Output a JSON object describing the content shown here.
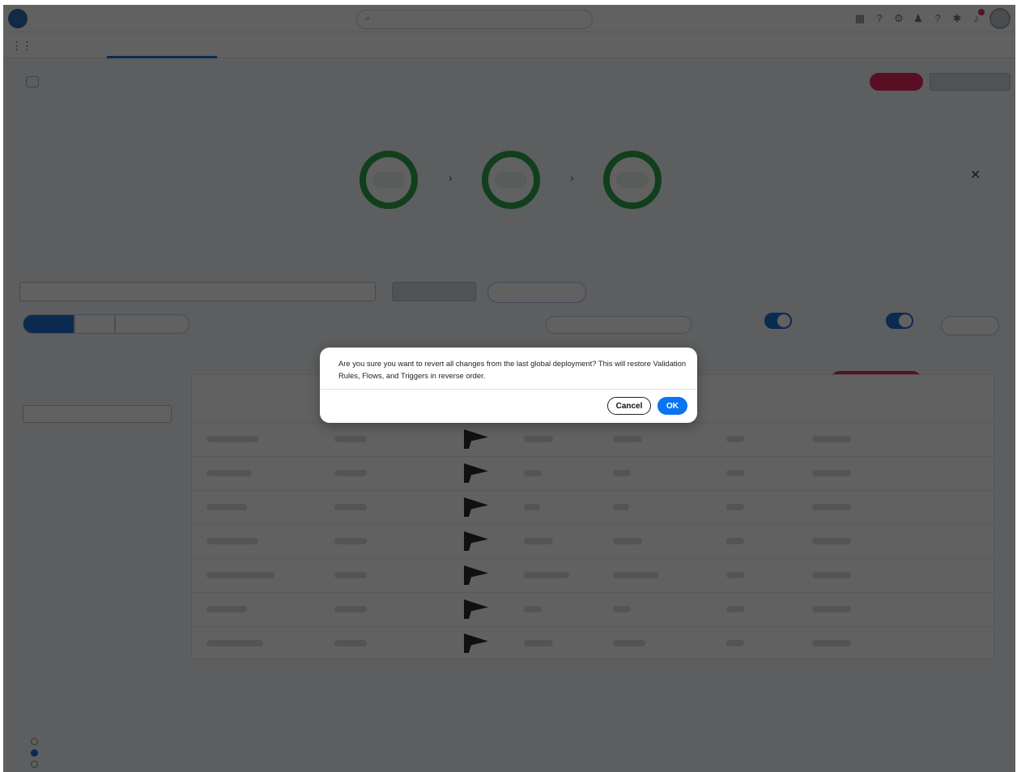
{
  "dialog": {
    "message": "Are you sure you want to revert all changes from the last global deployment? This will restore Validation Rules, Flows, and Triggers in reverse order.",
    "cancel_label": "Cancel",
    "ok_label": "OK"
  },
  "colors": {
    "primary": "#0b74f0",
    "accent_pink": "#e8285d",
    "ring_green": "#2ea54e",
    "overlay": "rgba(0,0,0,0.62)"
  },
  "icons": [
    "search-icon",
    "grid-icon",
    "bell-icon",
    "avatar-icon",
    "close-icon",
    "flag-icon",
    "chevron-right-icon"
  ]
}
